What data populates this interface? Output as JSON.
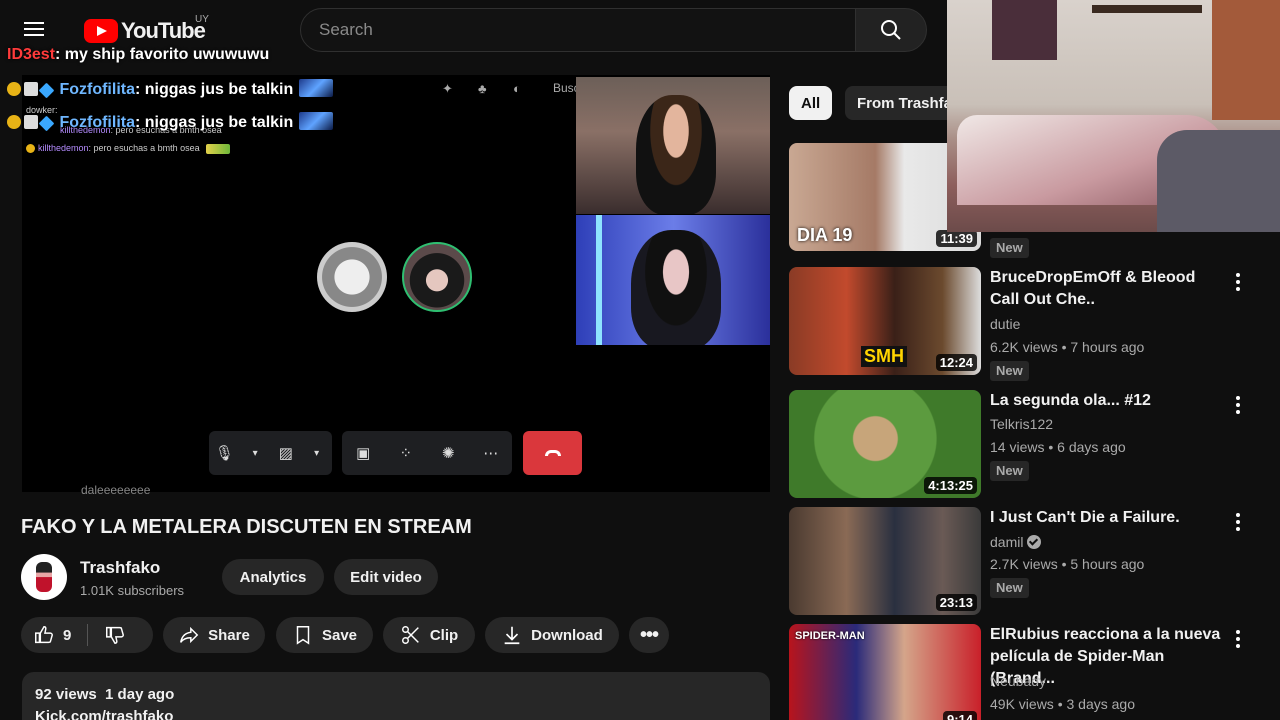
{
  "header": {
    "logo_text": "YouTube",
    "country_code": "UY",
    "search_placeholder": "Search"
  },
  "chat": {
    "line1_user": "ID3est",
    "line1_text": " my ship favorito uwuwuwu",
    "line2_user": "Fozfofilita",
    "line2_text": " niggas jus be talkin",
    "small1": "dowker:",
    "small2_user": "killthedemon",
    "small2_text": " pero esuchas a bmth osea",
    "line3_user": "Fozfofilita",
    "line3_text": " niggas jus be talkin",
    "small3_user": "killthedemon",
    "small3_text": " pero esuchas a bmth osea"
  },
  "player": {
    "top_label": "Busc",
    "under_text": "daleeeeeeee"
  },
  "video": {
    "title": "FAKO Y LA METALERA DISCUTEN EN STREAM",
    "channel": "Trashfako",
    "subscribers": "1.01K subscribers",
    "analytics_label": "Analytics",
    "edit_label": "Edit video",
    "likes": "9",
    "share_label": "Share",
    "save_label": "Save",
    "clip_label": "Clip",
    "download_label": "Download",
    "views_date": "92 views  1 day ago",
    "desc_link": "Kick.com/trashfako"
  },
  "sidebar": {
    "chips": [
      "All",
      "From Trashfako"
    ],
    "items": [
      {
        "thumb_text": "DIA 19",
        "duration": "11:39",
        "title": "",
        "channel": "",
        "meta": "",
        "badge": "New"
      },
      {
        "thumb_text": "SMH",
        "duration": "12:24",
        "title": "BruceDropEmOff & Bleood Call Out Che..",
        "channel": "dutie",
        "meta": "6.2K views • 7 hours ago",
        "badge": "New"
      },
      {
        "thumb_text": "",
        "duration": "4:13:25",
        "title": "La segunda ola... #12",
        "channel": "Telkris122",
        "meta": "14 views • 6 days ago",
        "badge": "New"
      },
      {
        "thumb_text": "",
        "duration": "23:13",
        "title": "I Just Can't Die a Failure.",
        "channel": "damil",
        "meta": "2.7K views • 5 hours ago",
        "badge": "New"
      },
      {
        "thumb_text": "SPIDER-MAN",
        "duration": "9:14",
        "title": "ElRubius reacciona a la nueva película de Spider-Man (Brand...",
        "channel": "Neubady",
        "meta": "49K views • 3 days ago",
        "badge": ""
      }
    ]
  },
  "colors": {
    "accent": "#ff0000",
    "end_call": "#da373c",
    "bg": "#0f0f0f"
  }
}
